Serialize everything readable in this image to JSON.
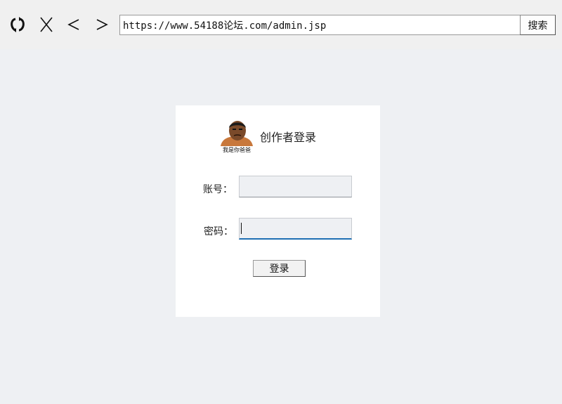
{
  "toolbar": {
    "refresh_icon": "refresh-icon",
    "stop_label": "X",
    "back_label": "<",
    "forward_label": ">",
    "url": "https://www.54188论坛.com/admin.jsp",
    "search_label": "搜索"
  },
  "login": {
    "title": "创作者登录",
    "avatar_caption": "我是你爸爸",
    "account_label": "账号：",
    "account_value": "",
    "password_label": "密码：",
    "password_value": "",
    "submit_label": "登录"
  },
  "colors": {
    "page_background": "#eef0f3",
    "card_background": "#ffffff",
    "focus_accent": "#1e6fb3"
  }
}
